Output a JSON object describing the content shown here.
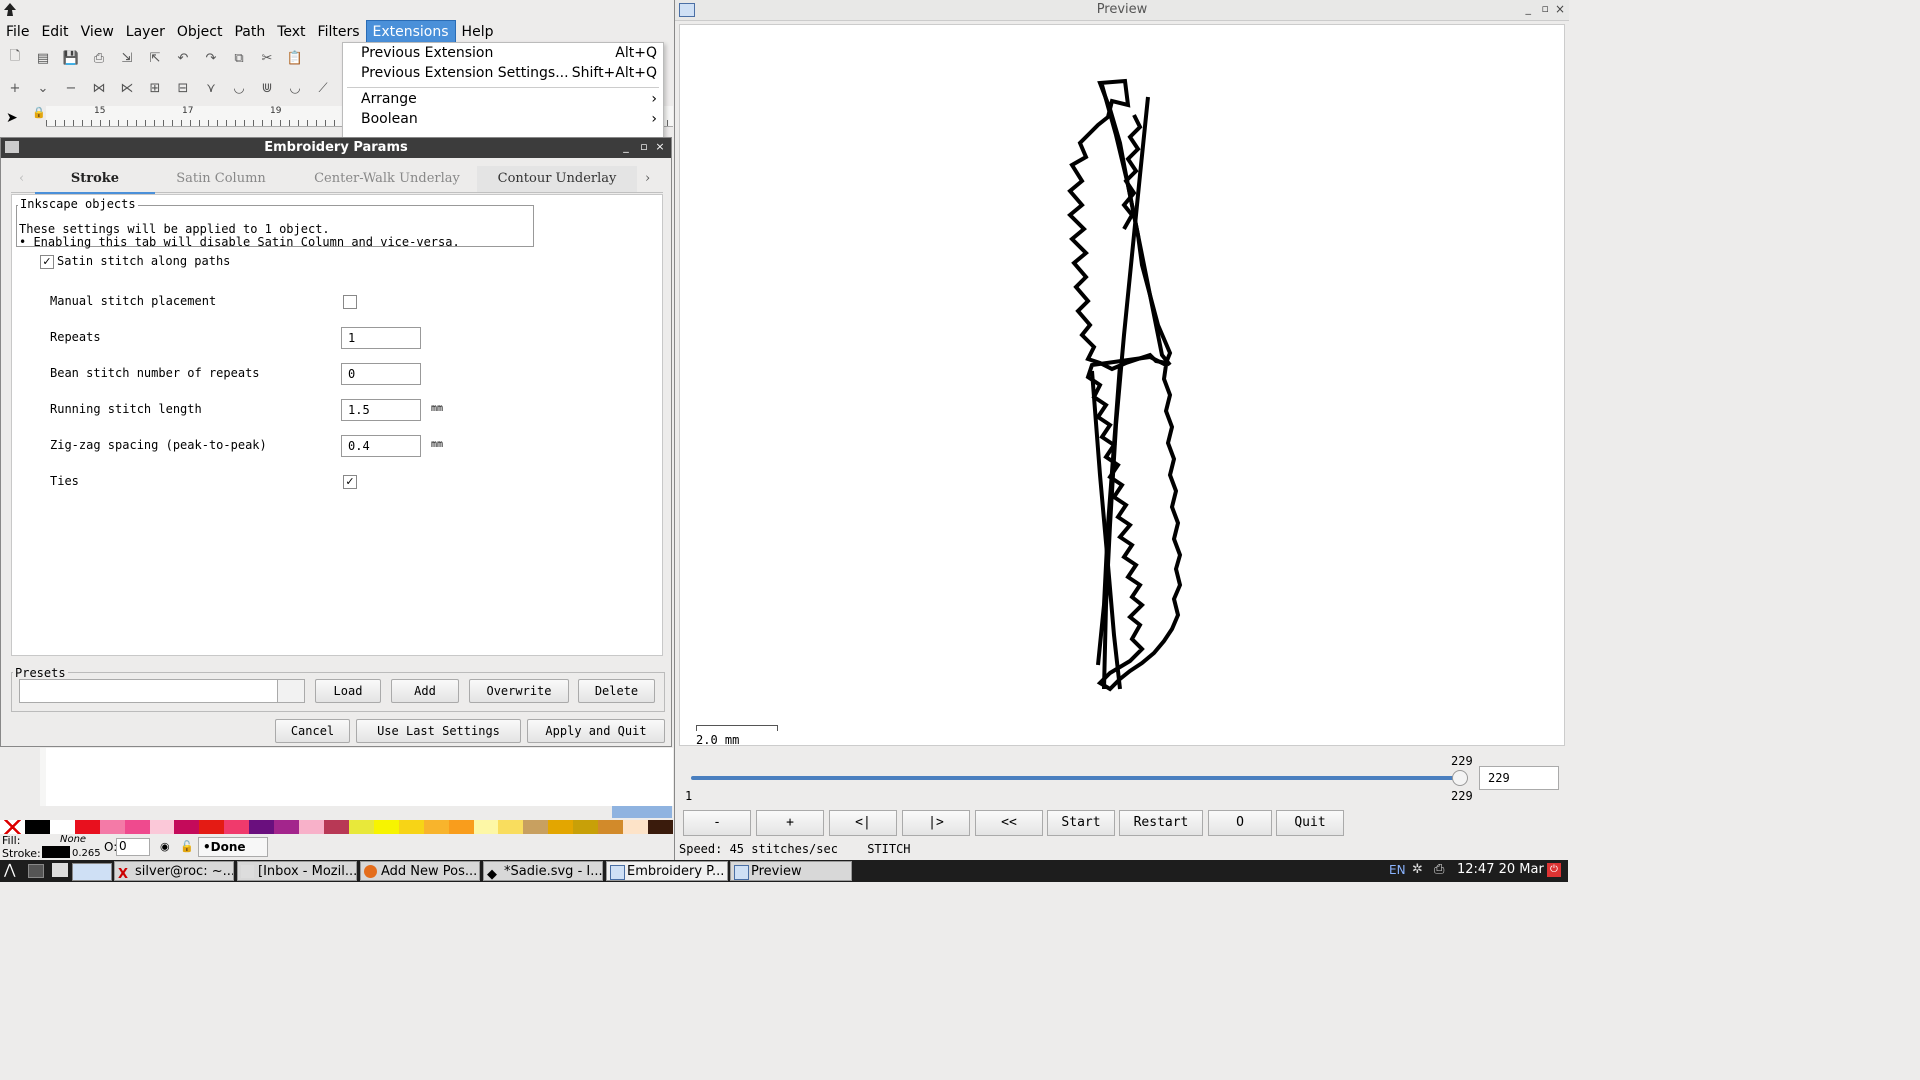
{
  "menubar": {
    "items": [
      "File",
      "Edit",
      "View",
      "Layer",
      "Object",
      "Path",
      "Text",
      "Filters",
      "Extensions",
      "Help"
    ],
    "active": "Extensions"
  },
  "ruler": {
    "ticks": [
      "15",
      "17",
      "19"
    ]
  },
  "extensions_menu": {
    "items": [
      {
        "label": "Previous Extension",
        "shortcut": "Alt+Q"
      },
      {
        "label": "Previous Extension Settings...",
        "shortcut": "Shift+Alt+Q"
      },
      {
        "label": "Arrange",
        "submenu": true
      },
      {
        "label": "Boolean",
        "submenu": true
      }
    ]
  },
  "dialog": {
    "title": "Embroidery Params",
    "tabs": [
      "Stroke",
      "Satin Column",
      "Center-Walk Underlay",
      "Contour Underlay"
    ],
    "active_tab": "Stroke",
    "info_legend": "Inkscape objects",
    "info_line1": "These settings will be applied to 1 object.",
    "info_line2": "• Enabling this tab will disable Satin Column and vice-versa.",
    "enable_label": "Satin stitch along paths",
    "enable_checked": true,
    "fields": {
      "manual": {
        "label": "Manual stitch placement",
        "checked": false
      },
      "repeats": {
        "label": "Repeats",
        "value": "1"
      },
      "bean": {
        "label": "Bean stitch number of repeats",
        "value": "0"
      },
      "running": {
        "label": "Running stitch length",
        "value": "1.5",
        "unit": "mm"
      },
      "zigzag": {
        "label": "Zig-zag spacing (peak-to-peak)",
        "value": "0.4",
        "unit": "mm"
      },
      "ties": {
        "label": "Ties",
        "checked": true
      }
    },
    "presets": {
      "legend": "Presets",
      "load": "Load",
      "add": "Add",
      "overwrite": "Overwrite",
      "delete": "Delete"
    },
    "buttons": {
      "cancel": "Cancel",
      "use_last": "Use Last Settings",
      "apply_quit": "Apply and Quit"
    }
  },
  "statusbar": {
    "fill_label": "Fill:",
    "fill_value": "None",
    "stroke_label": "Stroke:",
    "stroke_width": "0.265",
    "opacity_label": "O:",
    "opacity_value": "0",
    "layer_value": "•Done"
  },
  "palette": [
    "#ffffff",
    "#000000",
    "#ffffff",
    "#e8101e",
    "#f47aa7",
    "#ef4a8e",
    "#fbc8d8",
    "#c40a5a",
    "#e41b14",
    "#f03a6c",
    "#6a0f7e",
    "#a3258c",
    "#f8b1c9",
    "#b83855",
    "#e8e83a",
    "#f7f400",
    "#f7d416",
    "#f8b42c",
    "#f99d1c",
    "#fdf7a6",
    "#f9dd5e",
    "#c8a060",
    "#e3a600",
    "#c8a008",
    "#d28a2a",
    "#fde3c8",
    "#3a1b0c"
  ],
  "colors": {
    "accent": "#4a90d9",
    "titlebar": "#3c3c3c",
    "taskbar": "#1d1d1d"
  },
  "preview": {
    "title": "Preview",
    "scale_label": "2.0 mm",
    "slider_min": "1",
    "slider_max_top": "229",
    "slider_max_bottom": "229",
    "stitch_value": "229",
    "slider_fraction": 1.0,
    "buttons": [
      "-",
      "+",
      "<|",
      "|>",
      "<<",
      "Start",
      "Restart",
      "O",
      "Quit"
    ],
    "speed_text": "Speed: 45 stitches/sec",
    "mode_text": "STITCH"
  },
  "taskbar": {
    "tasks": [
      "silver@roc: ~...",
      "[Inbox - Mozil...",
      "Add New Pos...",
      "*Sadie.svg - I...",
      "Embroidery P...",
      "Preview"
    ],
    "lang": "EN",
    "clock": "12:47 20 Mar"
  }
}
